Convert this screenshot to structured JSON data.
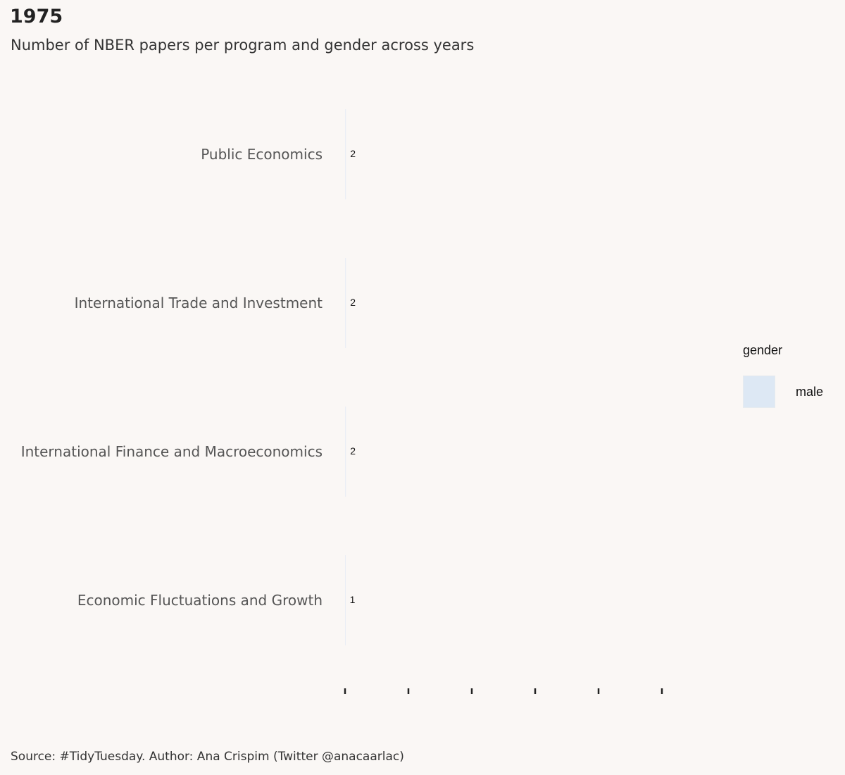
{
  "title": "1975",
  "subtitle": "Number of NBER papers per program and gender across years",
  "caption": "Source: #TidyTuesday. Author: Ana Crispim (Twitter @anacaarlac)",
  "legend": {
    "title": "gender",
    "items": [
      {
        "label": "male",
        "color": "#dde8f4"
      }
    ]
  },
  "chart_data": {
    "type": "bar",
    "orientation": "horizontal",
    "title": "1975",
    "subtitle": "Number of NBER papers per program and gender across years",
    "categories": [
      "Public Economics",
      "International Trade and Investment",
      "International Finance and Macroeconomics",
      "Economic Fluctuations and Growth"
    ],
    "series": [
      {
        "name": "male",
        "values": [
          2,
          2,
          2,
          1
        ],
        "color": "#dde8f4"
      }
    ],
    "x_ticks": 6,
    "grid": false,
    "legend_position": "right"
  }
}
